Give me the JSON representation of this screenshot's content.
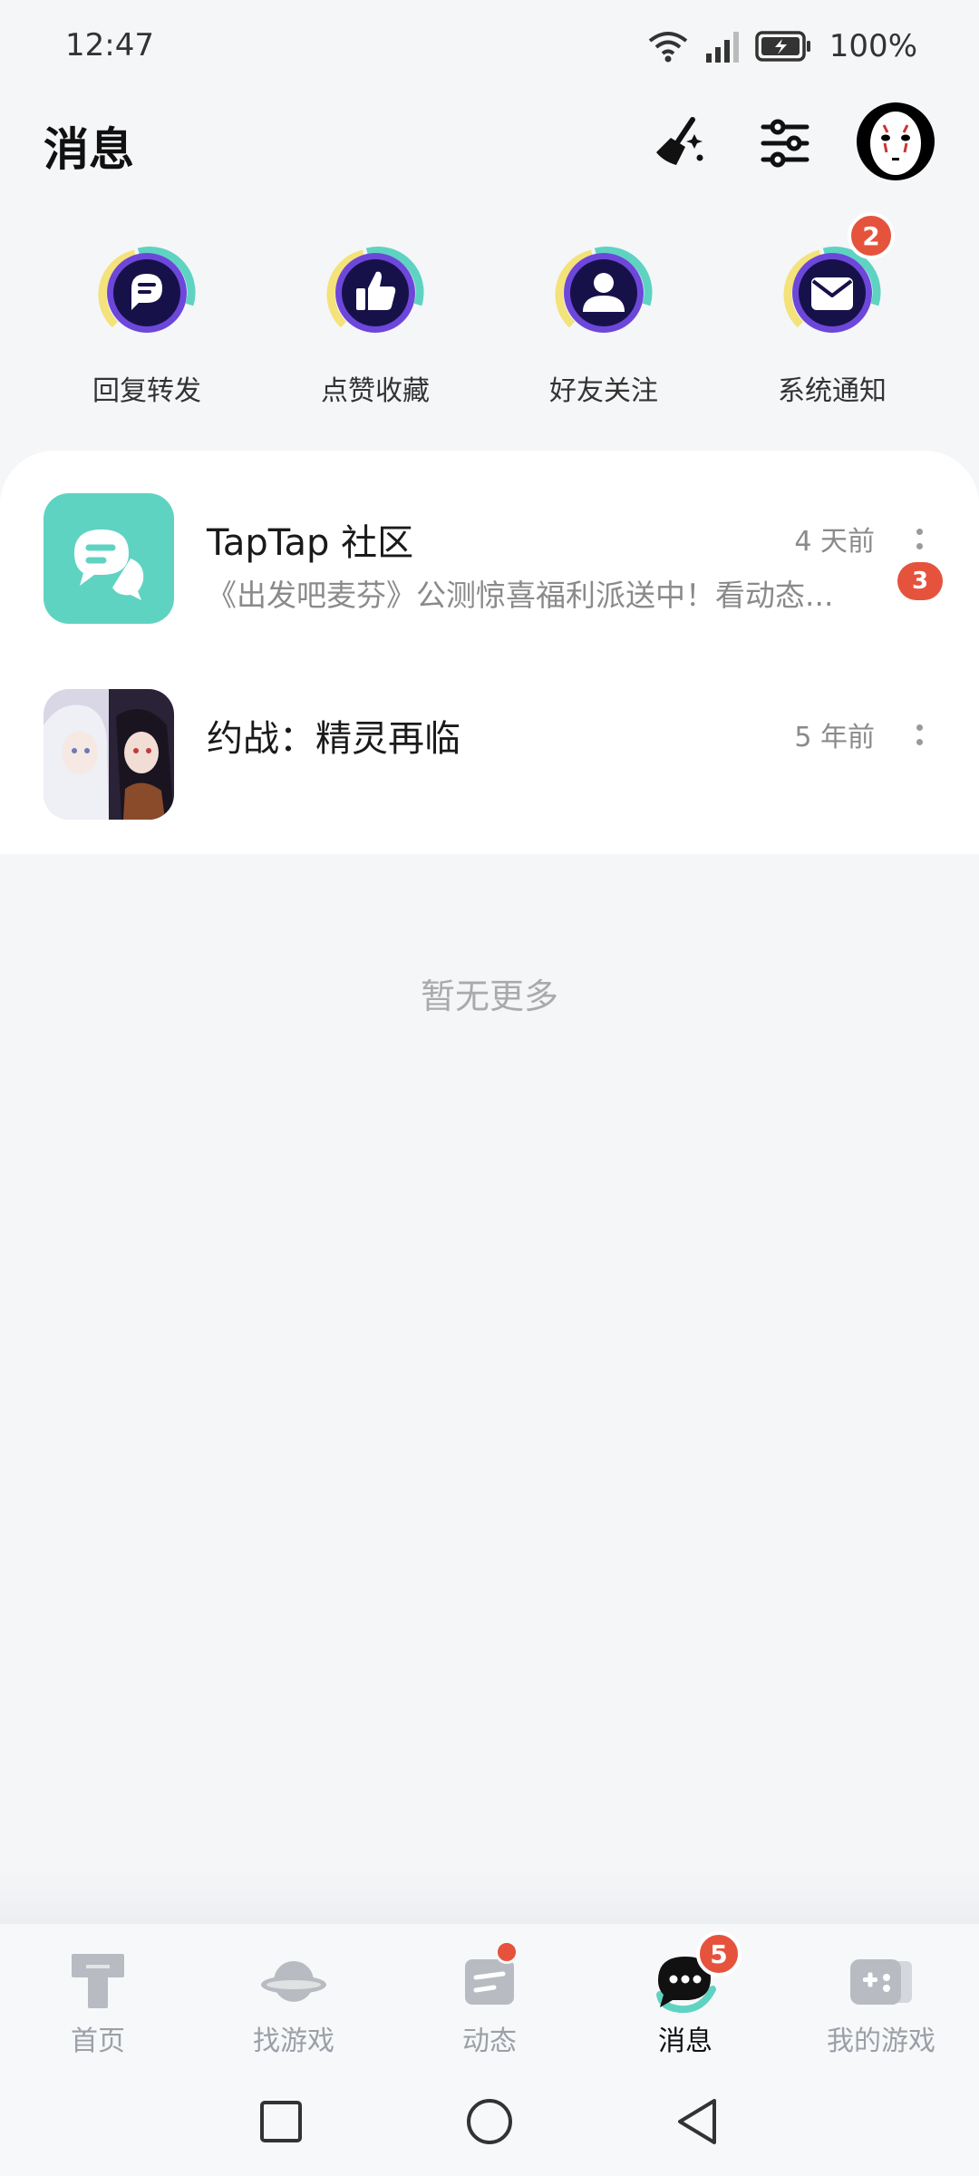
{
  "status_bar": {
    "time": "12:47",
    "battery": "100%"
  },
  "header": {
    "title": "消息"
  },
  "quick_actions": [
    {
      "label": "回复转发",
      "icon": "chat-bubble-icon"
    },
    {
      "label": "点赞收藏",
      "icon": "thumbs-up-icon"
    },
    {
      "label": "好友关注",
      "icon": "person-icon"
    },
    {
      "label": "系统通知",
      "icon": "envelope-icon",
      "badge": "2"
    }
  ],
  "conversations": [
    {
      "name": "TapTap 社区",
      "time": "4 天前",
      "preview": "《出发吧麦芬》公测惊喜福利派送中！看动态...",
      "badge": "3"
    },
    {
      "name": "约战：精灵再临",
      "time": "5 年前",
      "preview": ""
    }
  ],
  "empty_text": "暂无更多",
  "bottom_nav": [
    {
      "label": "首页",
      "icon": "home-icon"
    },
    {
      "label": "找游戏",
      "icon": "planet-icon"
    },
    {
      "label": "动态",
      "icon": "feed-icon"
    },
    {
      "label": "消息",
      "icon": "message-icon",
      "badge": "5",
      "active": true
    },
    {
      "label": "我的游戏",
      "icon": "gamepad-icon"
    }
  ],
  "colors": {
    "accent": "#5fd3c2",
    "badge": "#e5533d",
    "icon_dark": "#17114a",
    "icon_ring": "#6d47d9"
  }
}
